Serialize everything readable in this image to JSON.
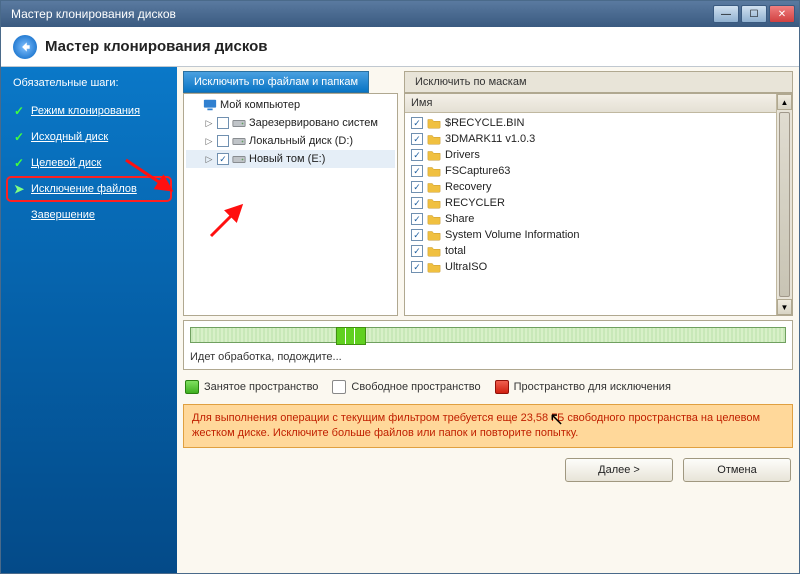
{
  "titlebar": {
    "text": "Мастер клонирования дисков"
  },
  "header": {
    "title": "Мастер клонирования дисков"
  },
  "sidebar": {
    "title": "Обязательные шаги:",
    "steps": [
      {
        "label": "Режим клонирования",
        "state": "done"
      },
      {
        "label": "Исходный диск",
        "state": "done"
      },
      {
        "label": "Целевой диск",
        "state": "done"
      },
      {
        "label": "Исключение файлов",
        "state": "current",
        "active": true
      },
      {
        "label": "Завершение",
        "state": ""
      }
    ]
  },
  "tabs": {
    "by_files": "Исключить по файлам и папкам",
    "by_masks": "Исключить по маскам"
  },
  "tree": {
    "root": "Мой компьютер",
    "items": [
      {
        "label": "Зарезервировано систем",
        "checked": false
      },
      {
        "label": "Локальный диск (D:)",
        "checked": false
      },
      {
        "label": "Новый том (E:)",
        "checked": true,
        "selected": true
      }
    ]
  },
  "list": {
    "header": "Имя",
    "items": [
      "$RECYCLE.BIN",
      "3DMARK11 v1.0.3",
      "Drivers",
      "FSCapture63",
      "Recovery",
      "RECYCLER",
      "Share",
      "System Volume Information",
      "total",
      "UltraISO"
    ]
  },
  "progress": {
    "label": "Идет обработка, подождите..."
  },
  "legend": {
    "used": "Занятое пространство",
    "free": "Свободное пространство",
    "excl": "Пространство для исключения"
  },
  "warning": "Для выполнения операции с текущим фильтром требуется еще 23,58 ГБ свободного пространства на целевом жестком диске. Исключите больше файлов или папок и повторите попытку.",
  "buttons": {
    "next": "Далее >",
    "cancel": "Отмена"
  }
}
